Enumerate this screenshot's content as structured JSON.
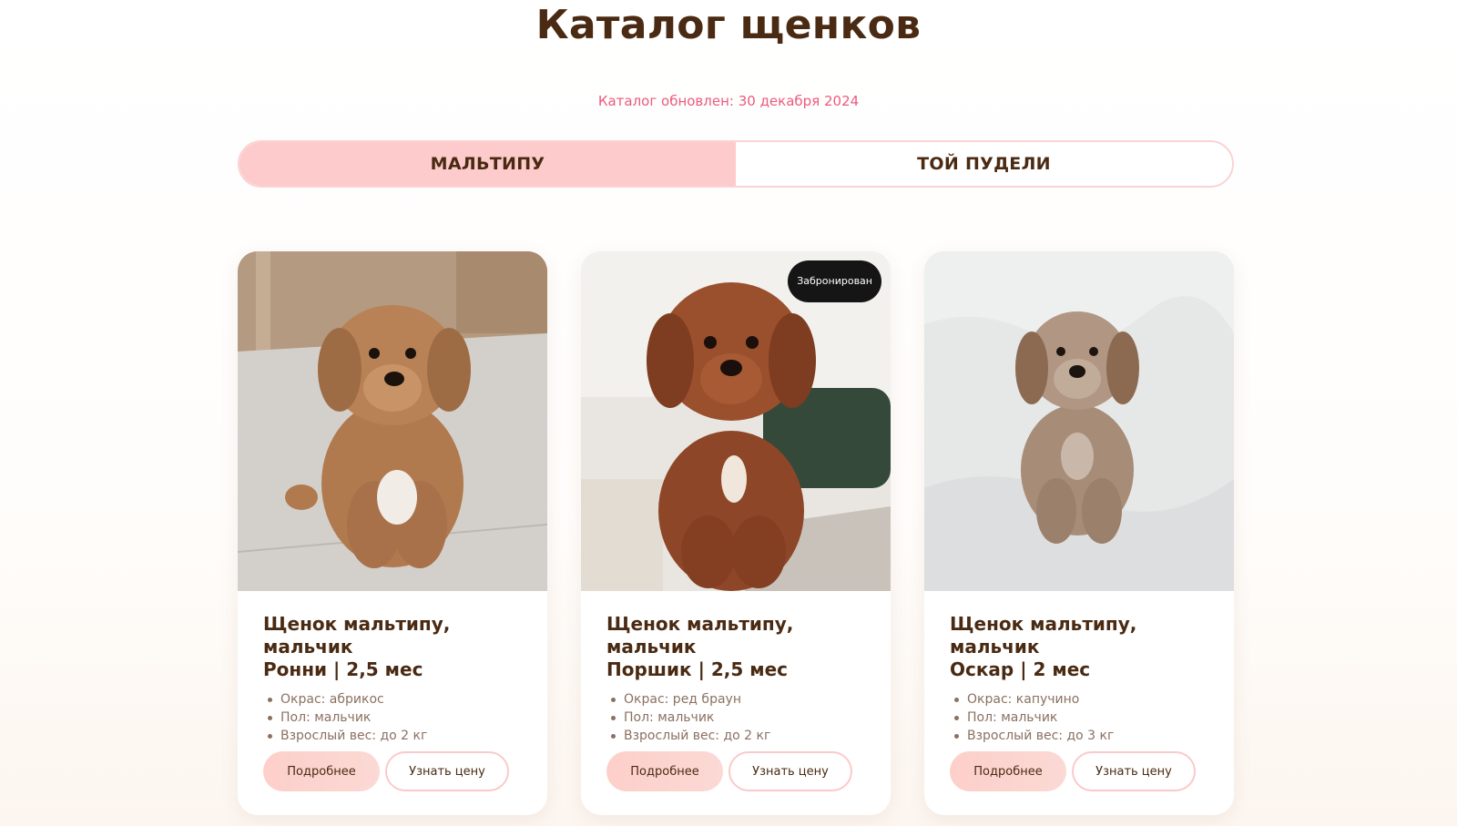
{
  "page": {
    "title": "Каталог щенков",
    "updated": "Каталог обновлен: 30 декабря 2024"
  },
  "tabs": [
    {
      "label": "МАЛЬТИПУ",
      "active": true
    },
    {
      "label": "ТОЙ ПУДЕЛИ",
      "active": false
    }
  ],
  "cards": [
    {
      "title_line1": "Щенок мальтипу, мальчик",
      "title_line2": "Ронни | 2,5 мес",
      "badge": "",
      "specs": [
        "Окрас: абрикос",
        "Пол: мальчик",
        "Взрослый вес: до 2 кг"
      ],
      "more_label": "Подробнее",
      "price_label": "Узнать цену"
    },
    {
      "title_line1": "Щенок мальтипу, мальчик",
      "title_line2": "Поршик | 2,5 мес",
      "badge": "Забронирован",
      "specs": [
        "Окрас: ред браун",
        "Пол: мальчик",
        "Взрослый вес: до 2 кг"
      ],
      "more_label": "Подробнее",
      "price_label": "Узнать цену"
    },
    {
      "title_line1": "Щенок мальтипу, мальчик",
      "title_line2": "Оскар | 2 мес",
      "badge": "",
      "specs": [
        "Окрас: капучино",
        "Пол: мальчик",
        "Взрослый вес: до 3 кг"
      ],
      "more_label": "Подробнее",
      "price_label": "Узнать цену"
    }
  ],
  "colors": {
    "accent_pink": "#fdcbcb",
    "brown_text": "#4a2a12",
    "date_pink": "#ec5a7d",
    "badge_bg": "#151515"
  }
}
